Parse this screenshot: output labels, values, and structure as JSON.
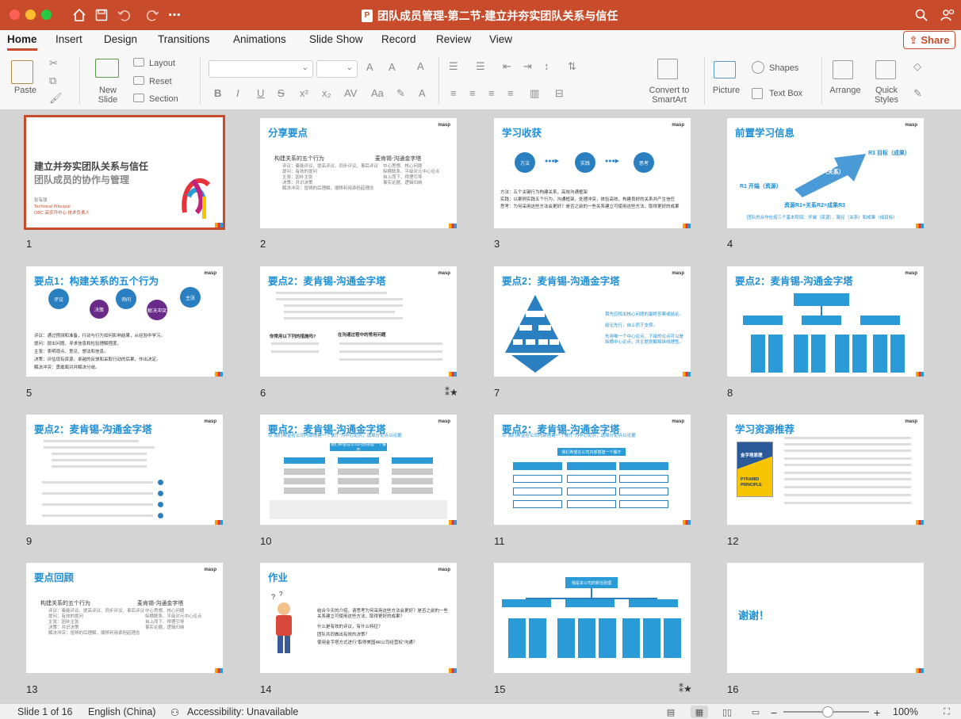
{
  "app": {
    "document_title": "团队成员管理-第二节-建立并夯实团队关系与信任",
    "ppt_glyph": "P"
  },
  "tabs": [
    "Home",
    "Insert",
    "Design",
    "Transitions",
    "Animations",
    "Slide Show",
    "Record",
    "Review",
    "View"
  ],
  "share_label": "Share",
  "ribbon": {
    "paste": "Paste",
    "new_slide_l1": "New",
    "new_slide_l2": "Slide",
    "layout": "Layout",
    "reset": "Reset",
    "section": "Section",
    "convert_l1": "Convert to",
    "convert_l2": "SmartArt",
    "picture": "Picture",
    "shapes": "Shapes",
    "text_box": "Text Box",
    "arrange": "Arrange",
    "quick_l1": "Quick",
    "quick_l2": "Styles"
  },
  "slides": {
    "s1": {
      "title1": "建立并夯实团队关系与信任",
      "title2": "团队成员的协作与管理",
      "author": "张有朋",
      "role": "Technical Principal",
      "dept": "OBC 高安开中心 技术负责人"
    },
    "logo": "masp",
    "s2": {
      "title": "分享要点",
      "left_head": "构建关系的五个行为",
      "right_head": "麦肯锡-沟通金字塔",
      "left_items": [
        "评议：奏能评议、提高评议、同步评议、事后评议",
        "提问：有效的提问",
        "主张：因补主张",
        "决策：共识决策",
        "解决冲突：冒辨的后理解，顺移利用承担起理念"
      ],
      "right_items": [
        "中心思想、核心问题",
        "纵横联系、平级对元中心论点",
        "自上而下、得理引导",
        "事实论据、逻辑归纳"
      ]
    },
    "s3": {
      "title": "学习收获",
      "c1": "方法",
      "c2": "实践",
      "c3": "思考",
      "lines": [
        "方法：五个关键行为构建关系，高效沟通框架",
        "实践：以案例实践五个行为，沟通框架，处理冲突，体验高效，构建良好的关系并产生信任",
        "思考：为何采用这些方法会更好？是否之前的一些关系建立可使用这些方法，取得更好的成果"
      ]
    },
    "s4": {
      "title": "前置学习信息",
      "r1": "R1 开端（资源）",
      "r2": "R2 路径（关系）",
      "r3": "R3 目标（成果）",
      "formula": "资源R1+关系R2=成果R3",
      "foot": "团队的合作包括三个基本阶段：开端（资源）、路径（关系）和成果（成目标）"
    },
    "s5": {
      "title": "要点1：构建关系的五个行为",
      "c1": "评议",
      "c2": "决策",
      "c3": "询问",
      "c4": "解决冲突",
      "c5": "主张",
      "lines": [
        "评议：通过预测和准备，行动与行为如何影响结果，从经验中学习。",
        "提问：提出问题、寻求信息和检验理解程度。",
        "主张：表明观点、意见、想法和信息。",
        "决策：评估现有资源，卓越的反馈和采取行动的后果，作出决定。",
        "解决冲突：勇敢面对并解决分歧。"
      ]
    },
    "s6": {
      "title": "要点2：麦肯锡-沟通金字塔",
      "h1": "你常用以下列的措施吗?",
      "h2": "在沟通过程中的常用问题"
    },
    "s7": {
      "title": "要点2：麦肯锡-沟通金字塔",
      "bullets": [
        "首先应找出核心问题的最终答案或结论。",
        "结论先行，自上而下支撑。",
        "先用唯一个中心论点，下级的论点可以是纵横中心论点，并主题划解释纵线理性。"
      ]
    },
    "s8": {
      "title": "要点2：麦肯锡-沟通金字塔"
    },
    "s9": {
      "title": "要点2：麦肯锡-沟通金字塔"
    },
    "s10": {
      "title": "要点2：麦肯锡-沟通金字塔",
      "subtitle": "以“我们希望在公司内部搭建一个餐厅”为中心论点，选择分论点以论据",
      "center": "我们希望在公司内部搭建一个餐厅"
    },
    "s11": {
      "title": "要点2：麦肯锡-沟通金字塔",
      "subtitle": "以“我们希望在公司内部搭建一个餐厅”为中心论点，选择分论点以论据",
      "center": "我们希望在公司内部搭建一个餐厅"
    },
    "s12": {
      "title": "学习资源推荐",
      "book": "PYRAMID PRINCIPLE",
      "book_cn": "金字塔原理"
    },
    "s13": {
      "title": "要点回顾",
      "left_head": "构建关系的五个行为",
      "right_head": "麦肯锡-沟通金字塔"
    },
    "s14": {
      "title": "作业",
      "items": [
        "结合今天的介绍，请思考为何采用这些方法会更好？是否之前的一些关系建立可使用这些方法，取得更好的成果？",
        "什么是有效的评议，有什么特征？",
        "团队共同做出有效的决策？",
        "使用金字塔方式进行“取得美国4R公司经营权”沟通？"
      ]
    },
    "s15": {
      "center": "我是本公司的新任经理"
    },
    "s16": {
      "text": "谢谢！"
    }
  },
  "status": {
    "slide": "Slide 1 of 16",
    "lang": "English (China)",
    "access": "Accessibility: Unavailable",
    "zoom": "100%"
  }
}
